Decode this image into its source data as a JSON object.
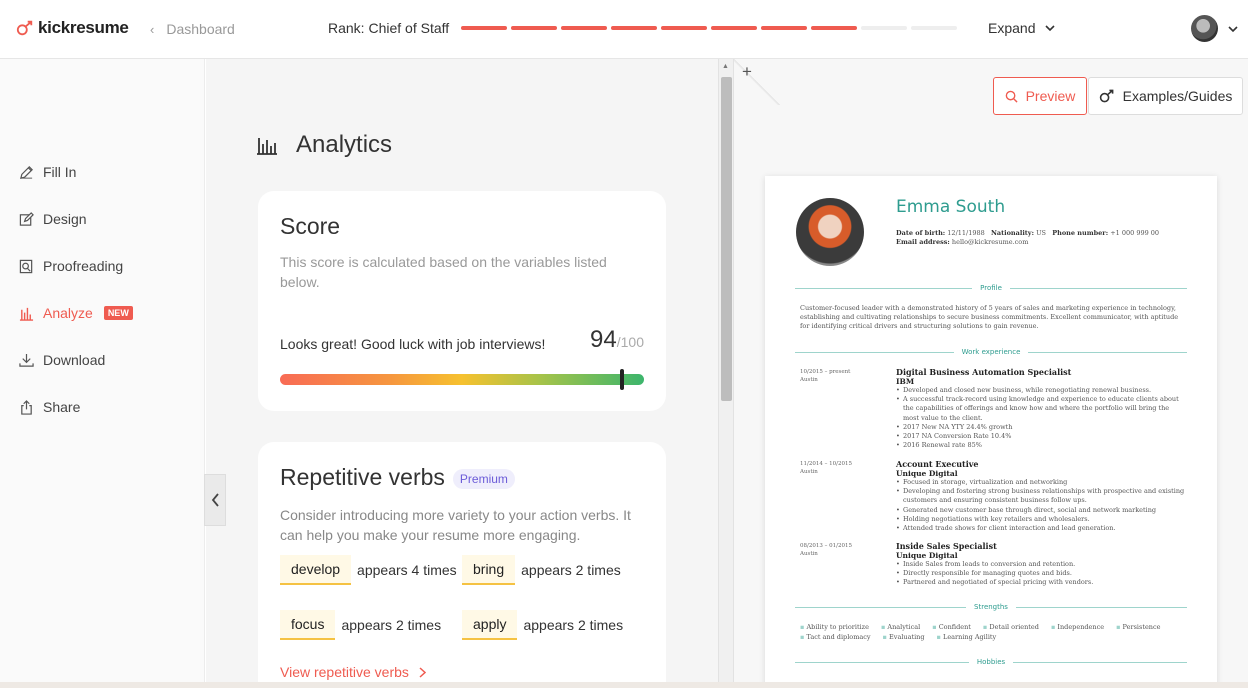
{
  "header": {
    "logo": "kickresume",
    "breadcrumb": "Dashboard",
    "rank_label": "Rank:",
    "rank_value": "Chief of Staff",
    "rank_progress": {
      "filled": 8,
      "total": 10
    },
    "expand_label": "Expand"
  },
  "sidebar": {
    "items": [
      {
        "label": "Fill In",
        "icon": "pencil-icon"
      },
      {
        "label": "Design",
        "icon": "pencil-square-icon"
      },
      {
        "label": "Proofreading",
        "icon": "magnifier-doc-icon"
      },
      {
        "label": "Analyze",
        "icon": "bar-chart-icon",
        "badge": "NEW",
        "active": true
      },
      {
        "label": "Download",
        "icon": "download-icon"
      },
      {
        "label": "Share",
        "icon": "share-icon"
      }
    ]
  },
  "analytics": {
    "title": "Analytics",
    "score_card": {
      "title": "Score",
      "description": "This score is calculated based on the variables listed below.",
      "message": "Looks great! Good luck with job interviews!",
      "score": "94",
      "max": "/100",
      "score_fraction": 0.94
    },
    "verbs_card": {
      "title": "Repetitive verbs",
      "badge": "Premium",
      "description": "Consider introducing more variety to your action verbs. It can help you make your resume more engaging.",
      "verbs": [
        {
          "word": "develop",
          "count": "appears 4 times"
        },
        {
          "word": "bring",
          "count": "appears 2 times"
        },
        {
          "word": "focus",
          "count": "appears 2 times"
        },
        {
          "word": "apply",
          "count": "appears 2 times"
        }
      ],
      "link": "View repetitive verbs"
    }
  },
  "right_panel": {
    "preview_label": "Preview",
    "examples_label": "Examples/Guides"
  },
  "resume": {
    "name": "Emma South",
    "meta_line1": {
      "dob_label": "Date of birth:",
      "dob": "12/11/1988",
      "nat_label": "Nationality:",
      "nat": "US",
      "phone_label": "Phone number:",
      "phone": "+1 000 999 00"
    },
    "meta_line2": {
      "email_label": "Email address:",
      "email": "hello@kickresume.com"
    },
    "sections": {
      "profile": "Profile",
      "work": "Work experience",
      "strengths": "Strengths",
      "hobbies": "Hobbies"
    },
    "profile_text": "Customer-focused leader with a demonstrated history of 5 years of sales and marketing experience in technology, establishing and cultivating relationships to secure business commitments. Excellent communicator, with aptitude for identifying critical drivers and structuring solutions to gain revenue.",
    "jobs": [
      {
        "date": "10/2015 – present",
        "location": "Austin",
        "title": "Digital Business Automation Specialist",
        "company": "IBM",
        "bullets": [
          "Developed and closed new business, while renegotiating renewal business.",
          "A successful track-record using knowledge and experience to educate clients about the capabilities of offerings and know how and where the portfolio will bring the most value to the client.",
          "2017 New NA YTY 24.4% growth",
          "2017 NA Conversion Rate 10.4%",
          "2016 Renewal rate 85%"
        ]
      },
      {
        "date": "11/2014 – 10/2015",
        "location": "Austin",
        "title": "Account Executive",
        "company": "Unique Digital",
        "bullets": [
          "Focused in storage, virtualization and networking",
          "Developing and fostering strong business relationships with prospective and existing customers and ensuring consistent business follow ups.",
          "Generated new customer base through direct, social and network marketing",
          "Holding negotiations with key retailers and wholesalers.",
          "Attended trade shows for client interaction and lead generation."
        ]
      },
      {
        "date": "08/2013 – 01/2015",
        "location": "Austin",
        "title": "Inside Sales Specialist",
        "company": "Unique Digital",
        "bullets": [
          "Inside Sales from leads to conversion and retention.",
          "Directly responsible for managing quotes and bids.",
          "Partnered and negotiated of special pricing with vendors."
        ]
      }
    ],
    "strengths": [
      "Ability to prioritize",
      "Analytical",
      "Confident",
      "Detail oriented",
      "Independence",
      "Persistence",
      "Tact and diplomacy",
      "Evaluating",
      "Learning Agility"
    ]
  }
}
